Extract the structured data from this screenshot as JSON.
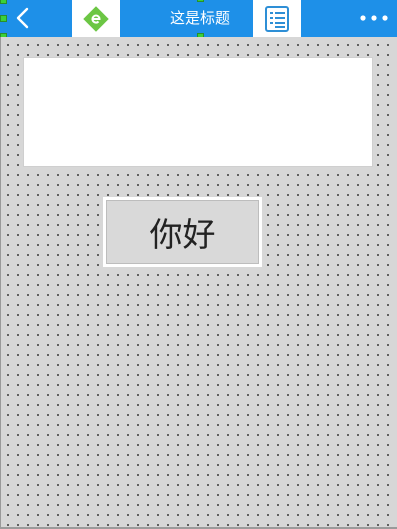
{
  "header": {
    "title": "这是标题",
    "back_icon": "chevron-left-icon",
    "logo_icon": "e-logo-icon",
    "list_icon": "list-icon",
    "more_icon": "more-dots-icon"
  },
  "main": {
    "text_area_value": "",
    "button_label": "你好"
  },
  "colors": {
    "header_bg": "#1e90e8",
    "accent_green": "#3ad13a"
  }
}
